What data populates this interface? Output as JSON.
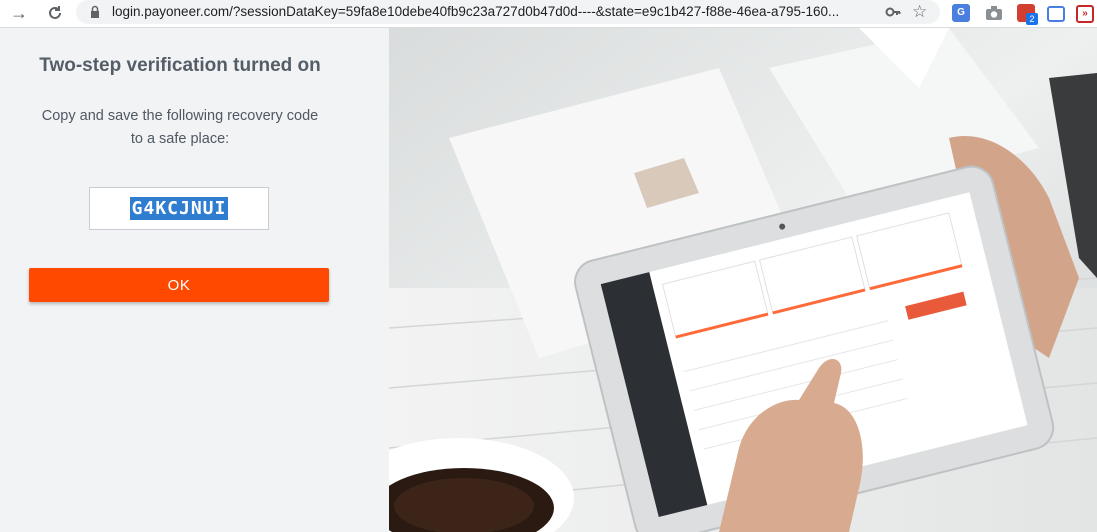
{
  "browser": {
    "url": "login.payoneer.com/?sessionDataKey=59fa8e10debe40fb9c23a727d0b47d0d----&state=e9c1b427-f88e-46ea-a795-160...",
    "extension_badge": "2",
    "icons": {
      "forward": "forward-arrow-icon",
      "reload": "reload-icon",
      "lock": "lock-icon",
      "key": "key-icon",
      "star": "star-icon"
    }
  },
  "verification": {
    "title": "Two-step verification turned on",
    "instruction_line1": "Copy and save the following recovery code",
    "instruction_line2": "to a safe place:",
    "recovery_code": "G4KCJNUI",
    "ok_label": "OK"
  },
  "colors": {
    "accent": "#ff4800",
    "selection": "#2f7dd1",
    "panel_bg": "#f2f3f5"
  }
}
